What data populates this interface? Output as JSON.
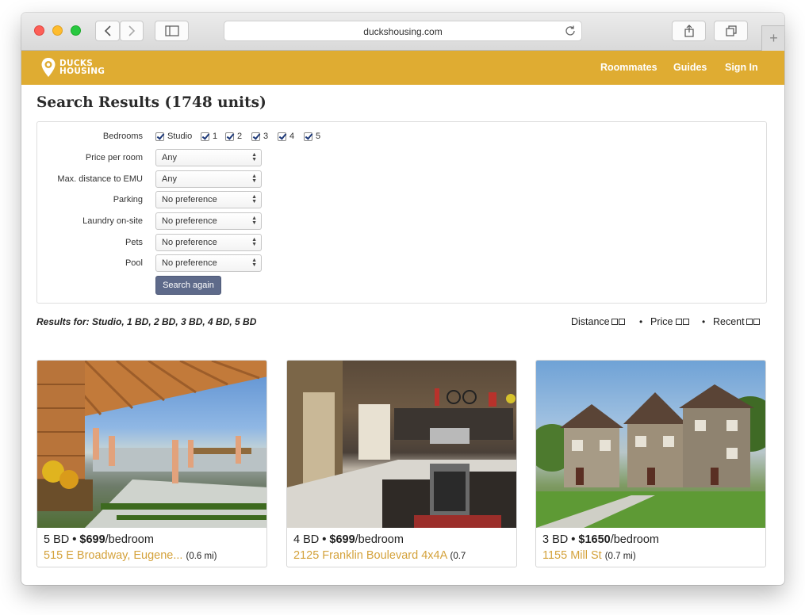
{
  "browser": {
    "url": "duckshousing.com"
  },
  "site": {
    "logo_line1": "DUCKS",
    "logo_line2": "HOUSING",
    "nav": [
      "Roommates",
      "Guides",
      "Sign In"
    ],
    "brand_color": "#dfac32"
  },
  "search": {
    "title": "Search Results (1748 units)",
    "filters": {
      "bedrooms_label": "Bedrooms",
      "bedroom_options": [
        "Studio",
        "1",
        "2",
        "3",
        "4",
        "5"
      ],
      "bedroom_checked": [
        true,
        true,
        true,
        true,
        true,
        true
      ],
      "fields": [
        {
          "label": "Price per room",
          "value": "Any"
        },
        {
          "label": "Max. distance to EMU",
          "value": "Any"
        },
        {
          "label": "Parking",
          "value": "No preference"
        },
        {
          "label": "Laundry on-site",
          "value": "No preference"
        },
        {
          "label": "Pets",
          "value": "No preference"
        },
        {
          "label": "Pool",
          "value": "No preference"
        }
      ],
      "submit_label": "Search again"
    },
    "results_for": "Results for: Studio, 1 BD, 2 BD, 3 BD, 4 BD, 5 BD",
    "sort": {
      "options": [
        "Distance",
        "Price",
        "Recent"
      ],
      "separator": "•"
    }
  },
  "listings": [
    {
      "beds": "5 BD",
      "sep": "•",
      "price": "$699",
      "unit": "/bedroom",
      "address": "515 E Broadway, Eugene...",
      "distance": "(0.6 mi)"
    },
    {
      "beds": "4 BD",
      "sep": "•",
      "price": "$699",
      "unit": "/bedroom",
      "address": "2125 Franklin Boulevard 4x4A",
      "distance": "(0.7"
    },
    {
      "beds": "3 BD",
      "sep": "•",
      "price": "$1650",
      "unit": "/bedroom",
      "address": "1155 Mill St",
      "distance": "(0.7 mi)"
    }
  ]
}
